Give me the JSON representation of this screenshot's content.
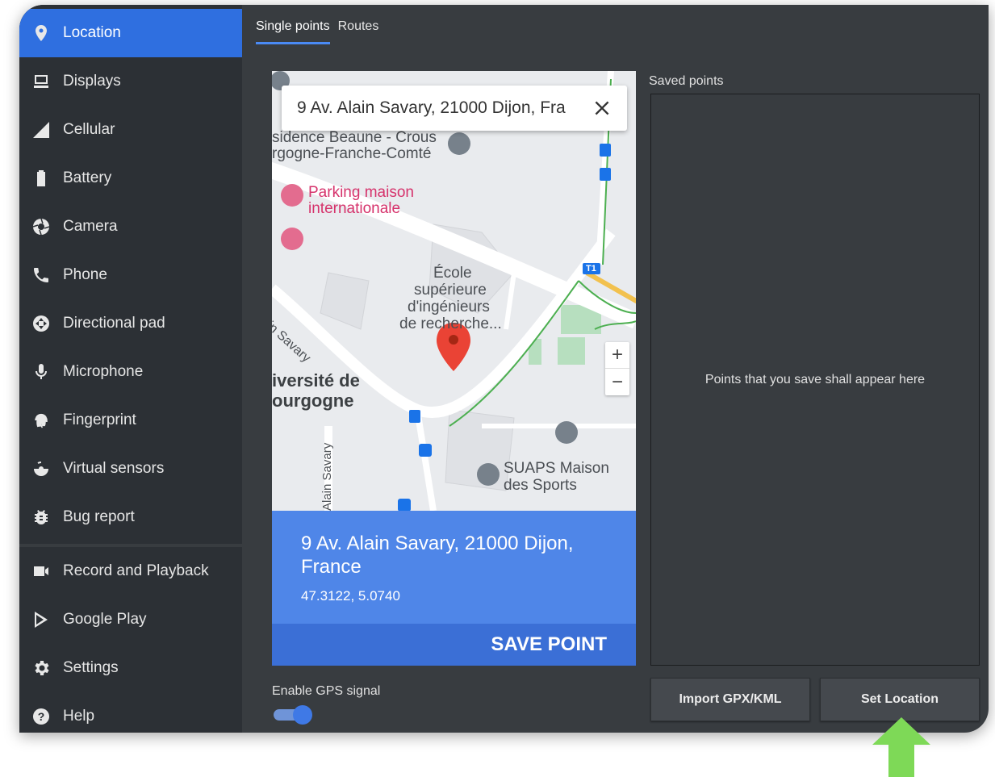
{
  "sidebar": {
    "items": [
      {
        "label": "Location",
        "icon": "location-pin-icon"
      },
      {
        "label": "Displays",
        "icon": "display-icon"
      },
      {
        "label": "Cellular",
        "icon": "cellular-signal-icon"
      },
      {
        "label": "Battery",
        "icon": "battery-icon"
      },
      {
        "label": "Camera",
        "icon": "camera-aperture-icon"
      },
      {
        "label": "Phone",
        "icon": "phone-icon"
      },
      {
        "label": "Directional pad",
        "icon": "dpad-icon"
      },
      {
        "label": "Microphone",
        "icon": "microphone-icon"
      },
      {
        "label": "Fingerprint",
        "icon": "fingerprint-icon"
      },
      {
        "label": "Virtual sensors",
        "icon": "rotate-sensor-icon"
      },
      {
        "label": "Bug report",
        "icon": "bug-icon"
      },
      {
        "label": "Record and Playback",
        "icon": "video-camera-icon"
      },
      {
        "label": "Google Play",
        "icon": "google-play-icon"
      },
      {
        "label": "Settings",
        "icon": "gear-icon"
      },
      {
        "label": "Help",
        "icon": "help-icon"
      }
    ]
  },
  "tabs": [
    {
      "label": "Single points",
      "active": true
    },
    {
      "label": "Routes",
      "active": false
    }
  ],
  "map": {
    "search_value": "9 Av. Alain Savary, 21000 Dijon, Fra",
    "labels": {
      "residence_1": "sidence Beaune - Crous",
      "residence_2": "rgogne-Franche-Comté",
      "parking_1": "Parking maison",
      "parking_2": "internationale",
      "ecole_1": "École",
      "ecole_2": "supérieure",
      "ecole_3": "d'ingénieurs",
      "ecole_4": "de recherche...",
      "univ_1": "iversité de",
      "univ_2": "ourgogne",
      "suaps_1": "SUAPS Maison",
      "suaps_2": "des Sports",
      "street_1": "ain Savary",
      "street_2": "Alain Savary",
      "tram": "T1",
      "zoom_in": "+",
      "zoom_out": "−"
    }
  },
  "info": {
    "address": "9 Av. Alain Savary, 21000 Dijon, France",
    "coords": "47.3122, 5.0740",
    "save_label": "SAVE POINT"
  },
  "gps": {
    "label": "Enable GPS signal",
    "enabled": true
  },
  "saved_points": {
    "label": "Saved points",
    "empty_text": "Points that you save shall appear here"
  },
  "buttons": {
    "import": "Import GPX/KML",
    "set_location": "Set Location"
  },
  "colors": {
    "accent": "#2f6fe0",
    "info_panel": "#4f86e8",
    "save_bar": "#3b6fd6",
    "arrow": "#7ed957"
  }
}
